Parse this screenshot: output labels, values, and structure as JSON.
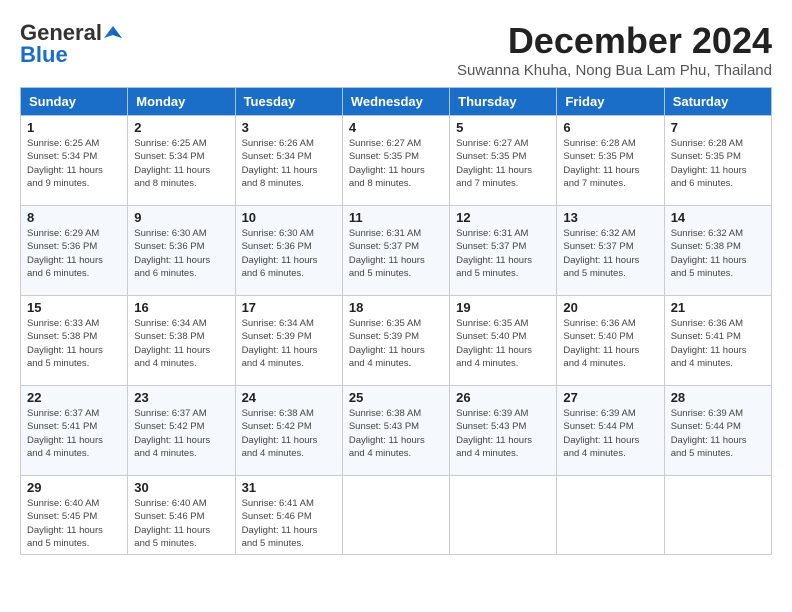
{
  "header": {
    "logo_general": "General",
    "logo_blue": "Blue",
    "month_year": "December 2024",
    "location": "Suwanna Khuha, Nong Bua Lam Phu, Thailand"
  },
  "days_of_week": [
    "Sunday",
    "Monday",
    "Tuesday",
    "Wednesday",
    "Thursday",
    "Friday",
    "Saturday"
  ],
  "weeks": [
    [
      {
        "day": 1,
        "sunrise": "6:25 AM",
        "sunset": "5:34 PM",
        "daylight": "11 hours and 9 minutes."
      },
      {
        "day": 2,
        "sunrise": "6:25 AM",
        "sunset": "5:34 PM",
        "daylight": "11 hours and 8 minutes."
      },
      {
        "day": 3,
        "sunrise": "6:26 AM",
        "sunset": "5:34 PM",
        "daylight": "11 hours and 8 minutes."
      },
      {
        "day": 4,
        "sunrise": "6:27 AM",
        "sunset": "5:35 PM",
        "daylight": "11 hours and 8 minutes."
      },
      {
        "day": 5,
        "sunrise": "6:27 AM",
        "sunset": "5:35 PM",
        "daylight": "11 hours and 7 minutes."
      },
      {
        "day": 6,
        "sunrise": "6:28 AM",
        "sunset": "5:35 PM",
        "daylight": "11 hours and 7 minutes."
      },
      {
        "day": 7,
        "sunrise": "6:28 AM",
        "sunset": "5:35 PM",
        "daylight": "11 hours and 6 minutes."
      }
    ],
    [
      {
        "day": 8,
        "sunrise": "6:29 AM",
        "sunset": "5:36 PM",
        "daylight": "11 hours and 6 minutes."
      },
      {
        "day": 9,
        "sunrise": "6:30 AM",
        "sunset": "5:36 PM",
        "daylight": "11 hours and 6 minutes."
      },
      {
        "day": 10,
        "sunrise": "6:30 AM",
        "sunset": "5:36 PM",
        "daylight": "11 hours and 6 minutes."
      },
      {
        "day": 11,
        "sunrise": "6:31 AM",
        "sunset": "5:37 PM",
        "daylight": "11 hours and 5 minutes."
      },
      {
        "day": 12,
        "sunrise": "6:31 AM",
        "sunset": "5:37 PM",
        "daylight": "11 hours and 5 minutes."
      },
      {
        "day": 13,
        "sunrise": "6:32 AM",
        "sunset": "5:37 PM",
        "daylight": "11 hours and 5 minutes."
      },
      {
        "day": 14,
        "sunrise": "6:32 AM",
        "sunset": "5:38 PM",
        "daylight": "11 hours and 5 minutes."
      }
    ],
    [
      {
        "day": 15,
        "sunrise": "6:33 AM",
        "sunset": "5:38 PM",
        "daylight": "11 hours and 5 minutes."
      },
      {
        "day": 16,
        "sunrise": "6:34 AM",
        "sunset": "5:38 PM",
        "daylight": "11 hours and 4 minutes."
      },
      {
        "day": 17,
        "sunrise": "6:34 AM",
        "sunset": "5:39 PM",
        "daylight": "11 hours and 4 minutes."
      },
      {
        "day": 18,
        "sunrise": "6:35 AM",
        "sunset": "5:39 PM",
        "daylight": "11 hours and 4 minutes."
      },
      {
        "day": 19,
        "sunrise": "6:35 AM",
        "sunset": "5:40 PM",
        "daylight": "11 hours and 4 minutes."
      },
      {
        "day": 20,
        "sunrise": "6:36 AM",
        "sunset": "5:40 PM",
        "daylight": "11 hours and 4 minutes."
      },
      {
        "day": 21,
        "sunrise": "6:36 AM",
        "sunset": "5:41 PM",
        "daylight": "11 hours and 4 minutes."
      }
    ],
    [
      {
        "day": 22,
        "sunrise": "6:37 AM",
        "sunset": "5:41 PM",
        "daylight": "11 hours and 4 minutes."
      },
      {
        "day": 23,
        "sunrise": "6:37 AM",
        "sunset": "5:42 PM",
        "daylight": "11 hours and 4 minutes."
      },
      {
        "day": 24,
        "sunrise": "6:38 AM",
        "sunset": "5:42 PM",
        "daylight": "11 hours and 4 minutes."
      },
      {
        "day": 25,
        "sunrise": "6:38 AM",
        "sunset": "5:43 PM",
        "daylight": "11 hours and 4 minutes."
      },
      {
        "day": 26,
        "sunrise": "6:39 AM",
        "sunset": "5:43 PM",
        "daylight": "11 hours and 4 minutes."
      },
      {
        "day": 27,
        "sunrise": "6:39 AM",
        "sunset": "5:44 PM",
        "daylight": "11 hours and 4 minutes."
      },
      {
        "day": 28,
        "sunrise": "6:39 AM",
        "sunset": "5:44 PM",
        "daylight": "11 hours and 5 minutes."
      }
    ],
    [
      {
        "day": 29,
        "sunrise": "6:40 AM",
        "sunset": "5:45 PM",
        "daylight": "11 hours and 5 minutes."
      },
      {
        "day": 30,
        "sunrise": "6:40 AM",
        "sunset": "5:46 PM",
        "daylight": "11 hours and 5 minutes."
      },
      {
        "day": 31,
        "sunrise": "6:41 AM",
        "sunset": "5:46 PM",
        "daylight": "11 hours and 5 minutes."
      },
      null,
      null,
      null,
      null
    ]
  ]
}
